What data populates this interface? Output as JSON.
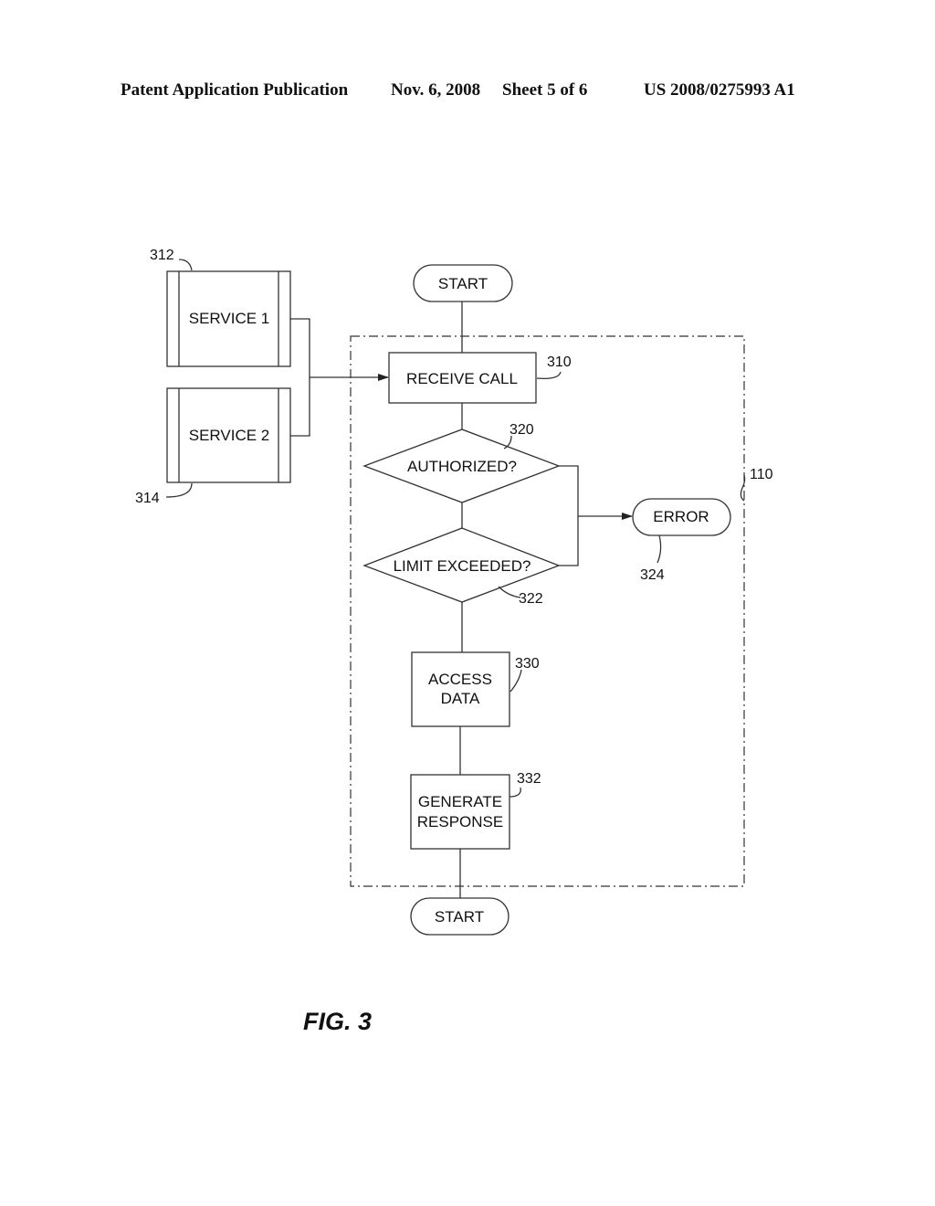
{
  "header": {
    "publication": "Patent Application Publication",
    "date": "Nov. 6, 2008",
    "sheet": "Sheet 5 of 6",
    "number": "US 2008/0275993 A1"
  },
  "figure_label": "FIG. 3",
  "diagram": {
    "services": [
      {
        "label": "SERVICE 1",
        "ref": "312"
      },
      {
        "label": "SERVICE 2",
        "ref": "314"
      }
    ],
    "container_ref": "110",
    "start_top": "START",
    "receive_call": {
      "label": "RECEIVE CALL",
      "ref": "310"
    },
    "authorized": {
      "label": "AUTHORIZED?",
      "ref": "320"
    },
    "limit_exceeded": {
      "label": "LIMIT EXCEEDED?",
      "ref": "322"
    },
    "error": {
      "label": "ERROR",
      "ref": "324"
    },
    "access_data": {
      "line1": "ACCESS",
      "line2": "DATA",
      "ref": "330"
    },
    "generate_response": {
      "line1": "GENERATE",
      "line2": "RESPONSE",
      "ref": "332"
    },
    "start_bottom": "START"
  }
}
